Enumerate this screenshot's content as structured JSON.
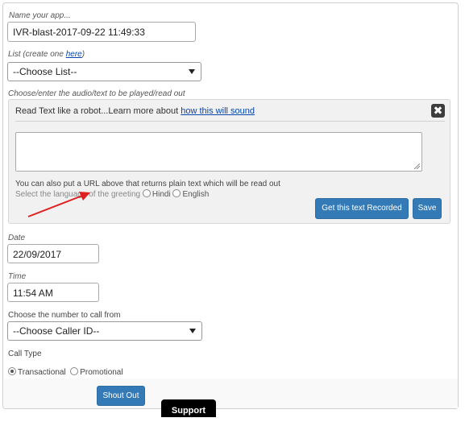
{
  "app_name": {
    "label": "Name your app...",
    "value": "IVR-blast-2017-09-22 11:49:33"
  },
  "list": {
    "label_prefix": "List (create one ",
    "link": "here",
    "label_suffix": ")",
    "selected": "--Choose List--"
  },
  "audio": {
    "label": "Choose/enter the audio/text to be played/read out",
    "panel_heading": "Read Text like a robot...Learn more about ",
    "panel_link": "how this will sound",
    "close_glyph": "✖",
    "textarea_value": "",
    "hint": "You can also put a URL above that returns plain text which will be read out",
    "language_prompt": "Select the language of the greeting",
    "language_options": [
      "Hindi",
      "English"
    ],
    "record_button": "Get this text Recorded",
    "save_button": "Save"
  },
  "date": {
    "label": "Date",
    "value": "22/09/2017"
  },
  "time": {
    "label": "Time",
    "value": "11:54 AM"
  },
  "caller": {
    "label": "Choose the number to call from",
    "selected": "--Choose Caller ID--"
  },
  "call_type": {
    "label": "Call Type",
    "options": [
      "Transactional",
      "Promotional"
    ],
    "selected": "Transactional"
  },
  "shout_button": "Shout Out",
  "support_button": "Support",
  "colors": {
    "primary": "#337ab7",
    "arrow": "#e02020",
    "support_bg": "#000000"
  }
}
